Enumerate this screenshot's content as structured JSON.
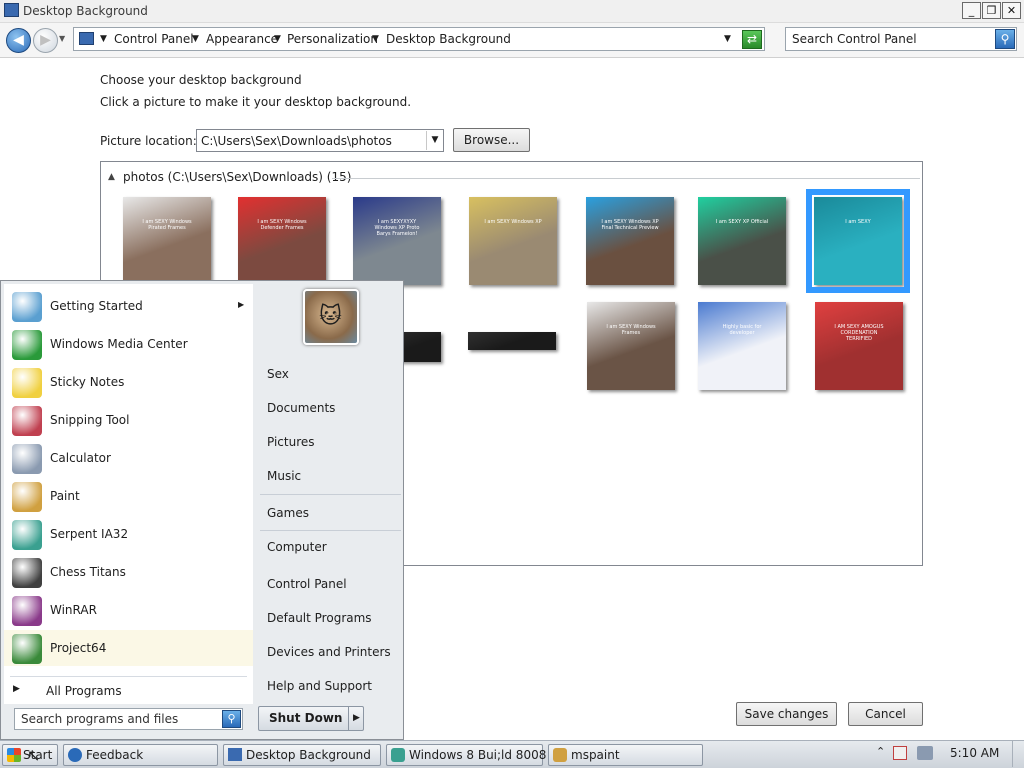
{
  "window": {
    "title": "Desktop Background"
  },
  "address": {
    "crumbs": [
      "Control Panel",
      "Appearance",
      "Personalization",
      "Desktop Background"
    ],
    "search_placeholder": "Search Control Panel"
  },
  "content": {
    "heading": "Choose your desktop background",
    "subheading": "Click a picture to make it your desktop background.",
    "picture_location_label": "Picture location:",
    "picture_location_value": "C:\\Users\\Sex\\Downloads\\photos",
    "browse_label": "Browse...",
    "group_label": "photos (C:\\Users\\Sex\\Downloads) (15)",
    "thumbs_row1": [
      {
        "caption": "I am SEXY Windows Pirated Frames",
        "color": "#8a6f5e",
        "accent": "#e8e8e8"
      },
      {
        "caption": "I am SEXY Windows Defender Frames",
        "color": "#7c4a40",
        "accent": "#e23030"
      },
      {
        "caption": "I am SEXYXYXY Windows XP Proto Barys Frameion!",
        "color": "#7e8890",
        "accent": "#2a3a8a"
      },
      {
        "caption": "I am SEXY Windows XP",
        "color": "#9a8a72",
        "accent": "#d8c060"
      },
      {
        "caption": "I am SEXY Windows XP Final Technical Preview",
        "color": "#6a5040",
        "accent": "#2aa0e0"
      },
      {
        "caption": "I am SEXY XP Official",
        "color": "#4a5048",
        "accent": "#20d0a0"
      },
      {
        "caption": "I am SEXY",
        "color": "#2ab0c0",
        "accent": "#1a8a9a"
      }
    ],
    "thumbs_row2": [
      {
        "caption": "",
        "color": "#1a1a1a",
        "accent": "#303030"
      },
      {
        "caption": "",
        "color": "#1a1a1a",
        "accent": "#303030"
      },
      {
        "caption": "I am SEXY Windows Frames",
        "color": "#6a5446",
        "accent": "#e8e8e8"
      },
      {
        "caption": "Highly basic for developer",
        "color": "#f0f2f8",
        "accent": "#4a7ad0"
      },
      {
        "caption": "I AM SEXY AMOGUS CORDENATION TERRIFIED",
        "color": "#a03030",
        "accent": "#e04040"
      }
    ],
    "save_label": "Save changes",
    "cancel_label": "Cancel"
  },
  "start_menu": {
    "programs": [
      {
        "label": "Getting Started",
        "icon": "getting-started-icon",
        "color": "#5a9fd0",
        "has_arrow": true
      },
      {
        "label": "Windows Media Center",
        "icon": "media-center-icon",
        "color": "#2a9a3a"
      },
      {
        "label": "Sticky Notes",
        "icon": "sticky-notes-icon",
        "color": "#f0d040"
      },
      {
        "label": "Snipping Tool",
        "icon": "snipping-tool-icon",
        "color": "#c04050"
      },
      {
        "label": "Calculator",
        "icon": "calculator-icon",
        "color": "#8a9ab0"
      },
      {
        "label": "Paint",
        "icon": "paint-icon",
        "color": "#d0a040"
      },
      {
        "label": "Serpent IA32",
        "icon": "serpent-icon",
        "color": "#3aa090"
      },
      {
        "label": "Chess Titans",
        "icon": "chess-icon",
        "color": "#404040"
      },
      {
        "label": "WinRAR",
        "icon": "winrar-icon",
        "color": "#8a3a8a"
      },
      {
        "label": "Project64",
        "icon": "project64-icon",
        "color": "#3a8a3a",
        "highlighted": true
      }
    ],
    "all_programs": "All Programs",
    "search_placeholder": "Search programs and files",
    "right_items": [
      "Sex",
      "Documents",
      "Pictures",
      "Music",
      "Games",
      "Computer",
      "Control Panel",
      "Default Programs",
      "Devices and Printers",
      "Help and Support"
    ],
    "shutdown_label": "Shut Down"
  },
  "taskbar": {
    "start_label": "Start",
    "tasks": [
      "Feedback",
      "Desktop Background",
      "Windows 8 Bui;ld 8008 ...",
      "mspaint"
    ],
    "clock": "5:10 AM"
  }
}
